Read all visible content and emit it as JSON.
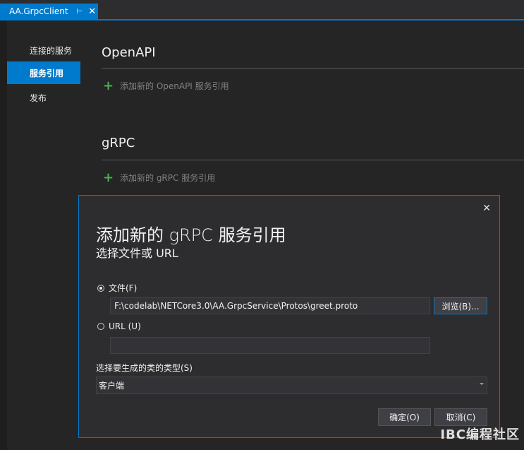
{
  "tab": {
    "title": "AA.GrpcClient",
    "pin_icon": "pin-icon",
    "close_icon": "close-icon"
  },
  "nav": {
    "items": [
      {
        "label": "连接的服务",
        "active": false
      },
      {
        "label": "服务引用",
        "active": true
      },
      {
        "label": "发布",
        "active": false
      }
    ]
  },
  "sections": {
    "openapi": {
      "title": "OpenAPI",
      "add_label": "添加新的 OpenAPI 服务引用"
    },
    "grpc": {
      "title": "gRPC",
      "add_label": "添加新的 gRPC 服务引用"
    }
  },
  "dialog": {
    "title": "添加新的 gRPC 服务引用",
    "subtitle": "选择文件或 URL",
    "file_option": {
      "label": "文件(F)",
      "selected": true
    },
    "file_path": "F:\\codelab\\NETCore3.0\\AA.GrpcService\\Protos\\greet.proto",
    "browse_label": "浏览(B)...",
    "url_option": {
      "label": "URL (U)",
      "selected": false
    },
    "url_value": "",
    "class_type_label": "选择要生成的类的类型(S)",
    "class_type_value": "客户端",
    "ok_label": "确定(O)",
    "cancel_label": "取消(C)"
  },
  "watermark": "IBC编程社区",
  "colors": {
    "accent": "#007acc",
    "background": "#252526",
    "plus": "#4caf50"
  }
}
